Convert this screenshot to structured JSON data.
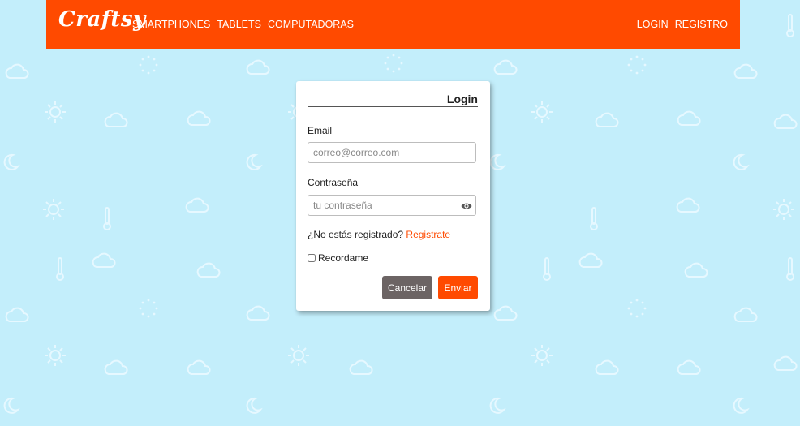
{
  "brand": {
    "logo_text": "Craftsy",
    "color": "#ff4a00"
  },
  "nav": {
    "left_links": [
      "SMARTPHONES",
      "TABLETS",
      "COMPUTADORAS"
    ],
    "right_links": [
      "LOGIN",
      "REGISTRO"
    ]
  },
  "login_card": {
    "title": "Login",
    "email_label": "Email",
    "email_placeholder": "correo@correo.com",
    "password_label": "Contraseña",
    "password_placeholder": "tu contraseña",
    "password_toggle_icon": "eye-icon",
    "register_prompt": "¿No estás registrado?",
    "register_link": "Registrate",
    "remember_label": "Recordame",
    "remember_checked": false,
    "cancel_label": "Cancelar",
    "submit_label": "Enviar"
  },
  "background": {
    "color": "#c3eefb",
    "pattern": "weather-icons"
  }
}
